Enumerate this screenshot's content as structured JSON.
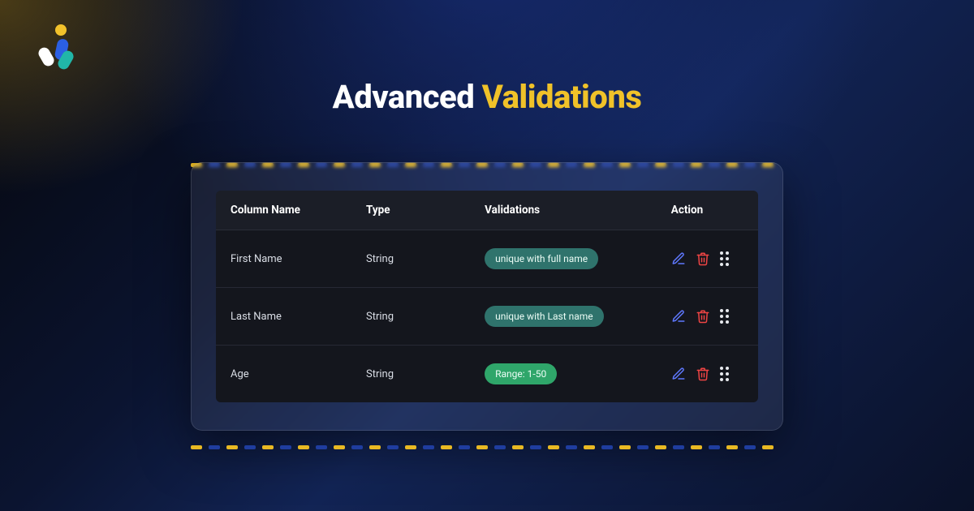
{
  "title": {
    "part1": "Advanced ",
    "part2": "Validations"
  },
  "logo": {
    "name": "impler-logo"
  },
  "table": {
    "headers": {
      "column_name": "Column Name",
      "type": "Type",
      "validations": "Validations",
      "action": "Action"
    },
    "rows": [
      {
        "name": "First Name",
        "type": "String",
        "validation": "unique with full name",
        "pill": "teal"
      },
      {
        "name": "Last Name",
        "type": "String",
        "validation": "unique with Last name",
        "pill": "teal"
      },
      {
        "name": "Age",
        "type": "String",
        "validation": "Range: 1-50",
        "pill": "green"
      }
    ]
  },
  "icons": {
    "edit": "edit-icon",
    "delete": "delete-icon",
    "drag": "drag-handle-icon"
  },
  "colors": {
    "accent_yellow": "#f0c229",
    "accent_blue": "#5f78ff",
    "danger_red": "#ef4444",
    "pill_teal": "#2f736c",
    "pill_green": "#2fa66a"
  }
}
